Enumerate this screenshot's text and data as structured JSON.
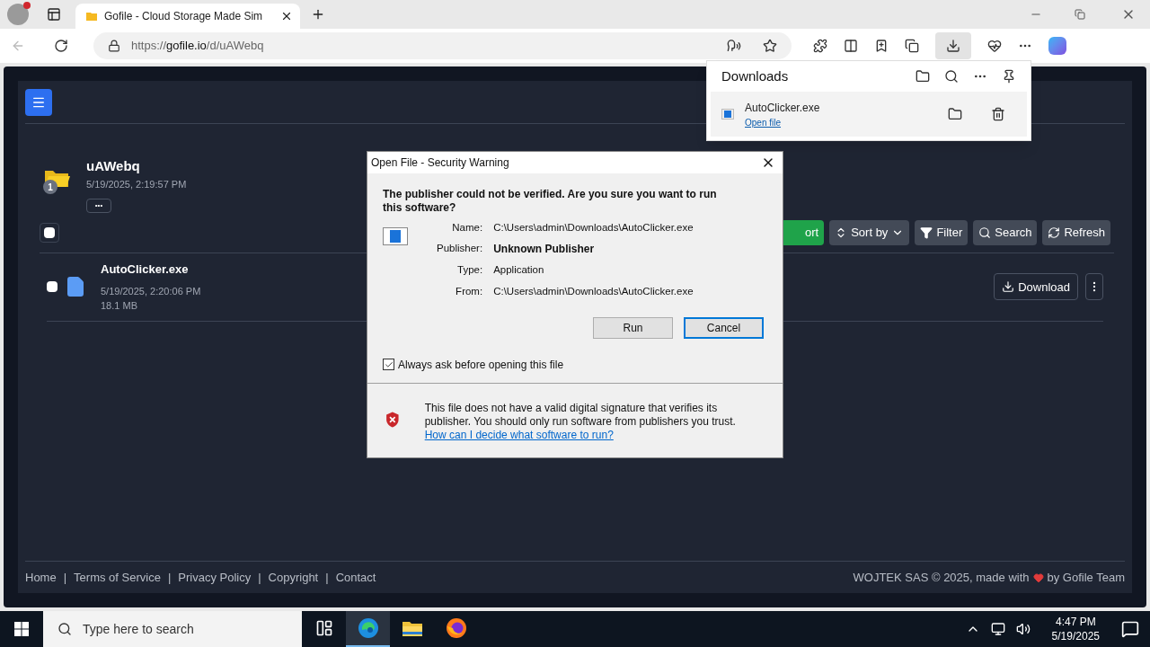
{
  "browser": {
    "tab": {
      "title": "Gofile - Cloud Storage Made Sim"
    },
    "address": {
      "scheme": "https://",
      "host": "gofile.io",
      "path": "/d/uAWebq"
    }
  },
  "downloads": {
    "title": "Downloads",
    "items": [
      {
        "name": "AutoClicker.exe",
        "action": "Open file"
      }
    ]
  },
  "page": {
    "folder": {
      "name": "uAWebq",
      "date": "5/19/2025, 2:19:57 PM",
      "badge": "1",
      "more": "•••"
    },
    "select_all": {
      "checked": false
    },
    "toolbar": [
      {
        "kind": "import",
        "label": "ort"
      },
      {
        "kind": "sort",
        "label": "Sort by"
      },
      {
        "kind": "filter",
        "label": "Filter"
      },
      {
        "kind": "search",
        "label": "Search"
      },
      {
        "kind": "refresh",
        "label": "Refresh"
      }
    ],
    "files": [
      {
        "name": "AutoClicker.exe",
        "date": "5/19/2025, 2:20:06 PM",
        "size": "18.1 MB",
        "checked": false,
        "download": "Download"
      }
    ],
    "footer": {
      "separator": "|",
      "links": [
        "Home",
        "Terms of Service",
        "Privacy Policy",
        "Copyright",
        "Contact"
      ],
      "credit_before": "WOJTEK SAS © 2025, made with",
      "credit_after": "by Gofile Team"
    }
  },
  "dialog": {
    "title": "Open File - Security Warning",
    "heading": "The publisher could not be verified.  Are you sure you want to run this software?",
    "fields": [
      {
        "label": "Name:",
        "value": "C:\\Users\\admin\\Downloads\\AutoClicker.exe",
        "bold": false
      },
      {
        "label": "Publisher:",
        "value": "Unknown Publisher",
        "bold": true
      },
      {
        "label": "Type:",
        "value": "Application",
        "bold": false
      },
      {
        "label": "From:",
        "value": "C:\\Users\\admin\\Downloads\\AutoClicker.exe",
        "bold": false
      }
    ],
    "buttons": [
      {
        "label": "Run",
        "focused": false
      },
      {
        "label": "Cancel",
        "focused": true
      }
    ],
    "checkbox": {
      "label": "Always ask before opening this file",
      "checked": true
    },
    "warning": "This file does not have a valid digital signature that verifies its publisher.  You should only run software from publishers you trust.",
    "link": "How can I decide what software to run?"
  },
  "taskbar": {
    "search_placeholder": "Type here to search",
    "apps": [
      {
        "kind": "taskview",
        "selected": false
      },
      {
        "kind": "edge",
        "selected": true
      },
      {
        "kind": "explorer",
        "selected": false
      },
      {
        "kind": "firefox",
        "selected": false
      }
    ],
    "time": "4:47 PM",
    "date": "5/19/2025"
  }
}
